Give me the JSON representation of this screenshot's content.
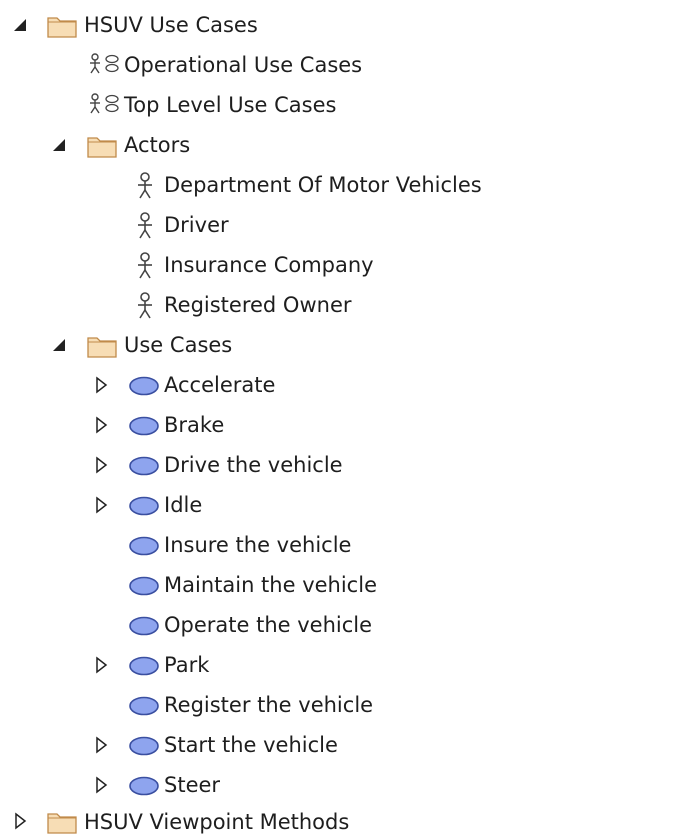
{
  "tree": {
    "root": {
      "label": "HSUV Use Cases",
      "children_diagrams": [
        {
          "label": "Operational Use Cases",
          "icon": "use-case-diagram-icon"
        },
        {
          "label": "Top Level Use Cases",
          "icon": "use-case-diagram-icon"
        }
      ],
      "actors": {
        "label": "Actors",
        "items": [
          "Department Of Motor Vehicles",
          "Driver",
          "Insurance Company",
          "Registered Owner"
        ]
      },
      "use_cases": {
        "label": "Use Cases",
        "items": [
          "Accelerate",
          "Brake",
          "Drive the vehicle",
          "Idle",
          "Insure the vehicle",
          "Maintain the vehicle",
          "Operate the vehicle",
          "Park",
          "Register the vehicle",
          "Start the vehicle",
          "Steer"
        ]
      }
    },
    "next_root": {
      "label": "HSUV Viewpoint Methods"
    }
  },
  "colors": {
    "folder_fill": "#f7ddb5",
    "folder_stroke": "#c08a4a",
    "use_case_fill": "#8ea4ee",
    "use_case_stroke": "#3a4fa0",
    "actor_stroke": "#444444",
    "toggle_color": "#222222"
  }
}
